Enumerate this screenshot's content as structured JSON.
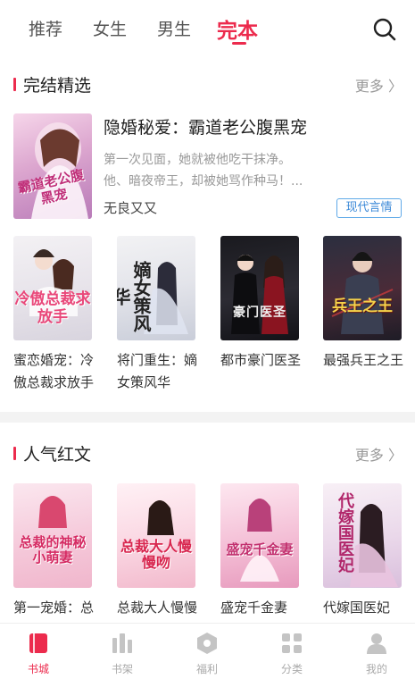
{
  "tabs": [
    {
      "label": "推荐"
    },
    {
      "label": "女生"
    },
    {
      "label": "男生"
    },
    {
      "label": "完本"
    }
  ],
  "active_tab": "完本",
  "search_icon": "search-icon",
  "section_finished": {
    "title": "完结精选",
    "more": "更多 〉",
    "featured": {
      "cover_title": "霸道老公腹黑宠",
      "title": "隐婚秘爱：霸道老公腹黑宠",
      "desc_line1": "第一次见面，她就被他吃干抹净。",
      "desc_line2": "他、暗夜帝王，却被她骂作种马！...",
      "author": "无良又又",
      "tag": "现代言情"
    },
    "books": [
      {
        "name": "蜜恋婚宠：冷傲总裁求放手",
        "cover_title": "冷傲总裁求放手"
      },
      {
        "name": "将门重生：嫡女策风华",
        "cover_title": "嫡女策风华"
      },
      {
        "name": "都市豪门医圣",
        "cover_title": "豪门医圣"
      },
      {
        "name": "最强兵王之王",
        "cover_title": "兵王之王"
      }
    ]
  },
  "section_popular": {
    "title": "人气红文",
    "more": "更多 〉",
    "books": [
      {
        "name": "第一宠婚：总裁的神秘小萌妻",
        "cover_title": "总裁的神秘小萌妻"
      },
      {
        "name": "总裁大人慢慢吻",
        "cover_title": "总裁大人慢慢吻"
      },
      {
        "name": "盛宠千金妻",
        "cover_title": "盛宠千金妻"
      },
      {
        "name": "代嫁国医妃",
        "cover_title": "代嫁国医妃"
      }
    ]
  },
  "bottom_nav": [
    {
      "label": "书城",
      "icon": "book-city-icon"
    },
    {
      "label": "书架",
      "icon": "bookshelf-icon"
    },
    {
      "label": "福利",
      "icon": "welfare-icon"
    },
    {
      "label": "分类",
      "icon": "category-icon"
    },
    {
      "label": "我的",
      "icon": "profile-icon"
    }
  ],
  "colors": {
    "accent": "#ec2b4d",
    "tag_blue": "#3d8ad8",
    "muted": "#999999"
  }
}
